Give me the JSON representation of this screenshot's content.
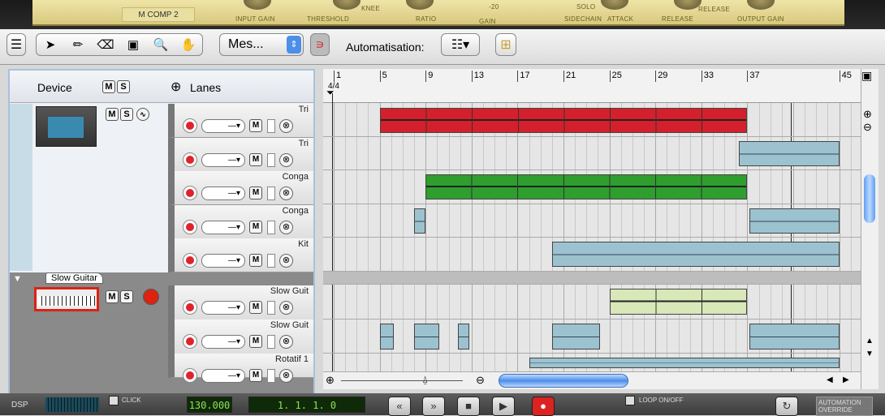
{
  "rack": {
    "device_name": "M COMP 2",
    "labels": [
      "INPUT GAIN",
      "THRESHOLD",
      "KNEE",
      "RATIO",
      "GAIN",
      "-20",
      "SOLO",
      "SIDECHAIN",
      "ATTACK",
      "RELEASE",
      "RELEASE",
      "OUTPUT GAIN"
    ]
  },
  "toolbar": {
    "snap_value": "Mes...",
    "automation_label": "Automatisation:"
  },
  "left": {
    "device_label": "Device",
    "m": "M",
    "s": "S",
    "lanes_label": "Lanes",
    "lanes": [
      {
        "name": "Tri"
      },
      {
        "name": "Tri"
      },
      {
        "name": "Conga"
      },
      {
        "name": "Conga"
      },
      {
        "name": "Kit"
      }
    ],
    "track2": {
      "name": "Slow Guitar",
      "lanes": [
        {
          "name": "Slow Guit"
        },
        {
          "name": "Slow Guit"
        },
        {
          "name": "Rotatif 1"
        }
      ]
    },
    "lane_m": "M",
    "dropdown": "—▾",
    "remove": "⊗"
  },
  "ruler": {
    "bars": [
      "1",
      "5",
      "9",
      "13",
      "17",
      "21",
      "25",
      "29",
      "33",
      "37",
      "45"
    ],
    "signature": "4/4"
  },
  "clips": [
    {
      "row": 0,
      "start": 5,
      "end": 37,
      "color": "#d4202c",
      "segments": 4
    },
    {
      "row": 1,
      "start": 36.3,
      "end": 45,
      "color": "#9cc2d0",
      "segments": 0
    },
    {
      "row": 2,
      "start": 9,
      "end": 37,
      "color": "#2e9e2e",
      "segments": 4
    },
    {
      "row": 3,
      "start": 8,
      "end": 9,
      "color": "#9cc2d0",
      "segments": 0
    },
    {
      "row": 3,
      "start": 37.2,
      "end": 45,
      "color": "#9cc2d0",
      "segments": 0
    },
    {
      "row": 4,
      "start": 20,
      "end": 45,
      "color": "#9cc2d0",
      "segments": 0
    },
    {
      "row": 5,
      "start": 25,
      "end": 37,
      "color": "#d8e8b8",
      "segments": 4
    },
    {
      "row": 6,
      "start": 5,
      "end": 6.2,
      "color": "#9cc2d0",
      "segments": 0
    },
    {
      "row": 6,
      "start": 8,
      "end": 10.2,
      "color": "#9cc2d0",
      "segments": 0
    },
    {
      "row": 6,
      "start": 11.8,
      "end": 12.8,
      "color": "#9cc2d0",
      "segments": 0
    },
    {
      "row": 6,
      "start": 20,
      "end": 24.2,
      "color": "#9cc2d0",
      "segments": 0
    },
    {
      "row": 6,
      "start": 37.2,
      "end": 45,
      "color": "#9cc2d0",
      "segments": 0
    },
    {
      "row": 7,
      "start": 18,
      "end": 45,
      "color": "#9cc2d0",
      "segments": 0
    }
  ],
  "transport": {
    "dsp": "DSP",
    "click": "CLICK",
    "tempo": "130.000",
    "position": "1. 1. 1.   0",
    "loop": "LOOP ON/OFF",
    "automation_override": "AUTOMATION OVERRIDE"
  }
}
